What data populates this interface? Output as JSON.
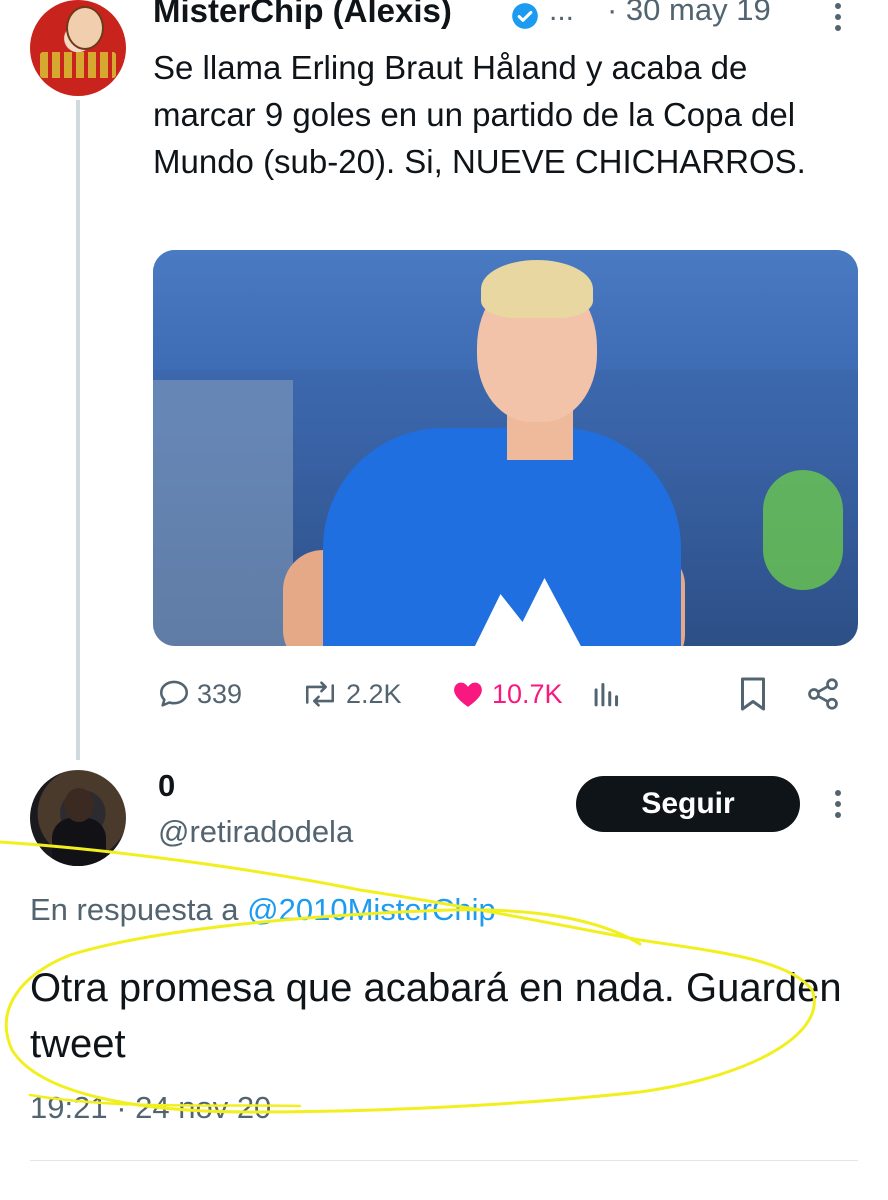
{
  "original_tweet": {
    "display_name": "MisterChip (Alexis)",
    "ellipsis": "...",
    "date": "· 30 may 19",
    "text": "Se llama Erling Braut Håland y acaba de marcar 9 goles en un partido de la Copa del Mundo (sub-20). Si, NUEVE CHICHARROS.",
    "media_icon": "player-photo",
    "stats": {
      "replies": "339",
      "retweets": "2.2K",
      "likes": "10.7K"
    },
    "like_color": "#f91880"
  },
  "reply_tweet": {
    "display_name": "0",
    "handle": "@retiradodela",
    "follow_label": "Seguir",
    "replying_prefix": "En respuesta a ",
    "replying_to": "@2010MisterChip",
    "text": "Otra promesa que acabará en nada. Guarden tweet",
    "timestamp": "19:21 · 24 nov 20"
  },
  "colors": {
    "link": "#1d9bf0",
    "muted": "#536471",
    "annotation_highlight": "#f2ef1f"
  }
}
